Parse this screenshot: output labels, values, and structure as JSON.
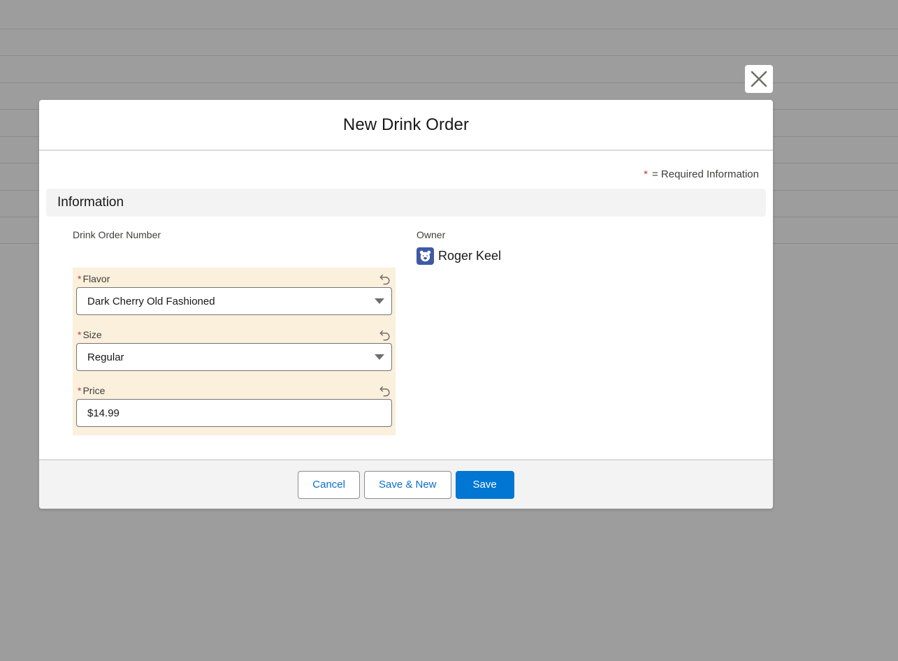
{
  "modal": {
    "title": "New Drink Order",
    "required_note": "= Required Information",
    "required_star": "*"
  },
  "section": {
    "title": "Information"
  },
  "fields": {
    "drink_order_number": {
      "label": "Drink Order Number"
    },
    "owner": {
      "label": "Owner",
      "value": "Roger Keel",
      "avatar_icon": "bear-avatar-icon"
    },
    "flavor": {
      "label": "Flavor",
      "value": "Dark Cherry Old Fashioned"
    },
    "size": {
      "label": "Size",
      "value": "Regular"
    },
    "price": {
      "label": "Price",
      "value": "$14.99"
    }
  },
  "footer": {
    "cancel_label": "Cancel",
    "save_new_label": "Save & New",
    "save_label": "Save"
  },
  "colors": {
    "brand": "#0176d3",
    "required": "#c23934",
    "edited_highlight": "#faf0dc",
    "overlay": "#9d9d9d"
  }
}
